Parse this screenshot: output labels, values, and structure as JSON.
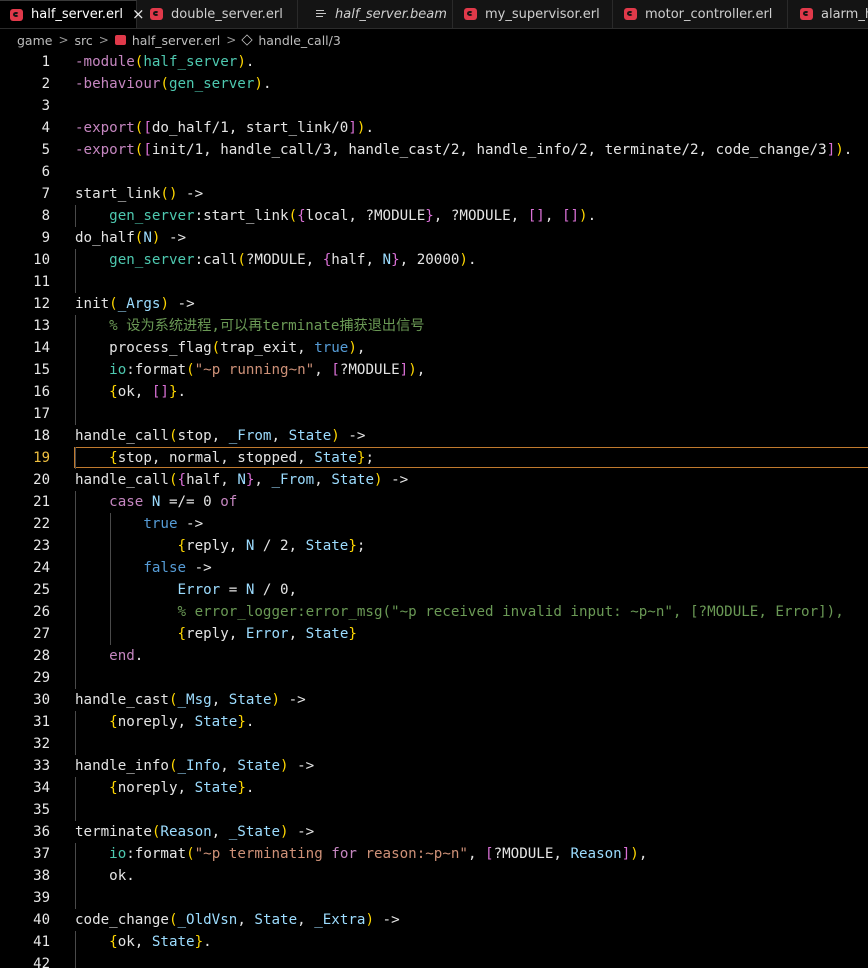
{
  "tabs": [
    {
      "label": "half_server.erl",
      "active": true,
      "icon": "erlang-file-icon",
      "close": "×"
    },
    {
      "label": "double_server.erl",
      "active": false,
      "icon": "erlang-file-icon"
    },
    {
      "label": "half_server.beam",
      "active": false,
      "icon": "beam-file-icon"
    },
    {
      "label": "my_supervisor.erl",
      "active": false,
      "icon": "erlang-file-icon"
    },
    {
      "label": "motor_controller.erl",
      "active": false,
      "icon": "erlang-file-icon"
    },
    {
      "label": "alarm_ha",
      "active": false,
      "icon": "erlang-file-icon"
    }
  ],
  "breadcrumb": {
    "parts": [
      "game",
      "src",
      "half_server.erl",
      "handle_call/3"
    ],
    "separator": ">"
  },
  "editor": {
    "current_line": 19,
    "lines": [
      {
        "n": "1",
        "t": [
          [
            "-module",
            "kw"
          ],
          [
            "(",
            "p1"
          ],
          [
            "half_server",
            "mod"
          ],
          [
            ")",
            "p1"
          ],
          [
            ".",
            "plain"
          ]
        ]
      },
      {
        "n": "2",
        "t": [
          [
            "-behaviour",
            "kw"
          ],
          [
            "(",
            "p1"
          ],
          [
            "gen_server",
            "mod"
          ],
          [
            ")",
            "p1"
          ],
          [
            ".",
            "plain"
          ]
        ]
      },
      {
        "n": "3",
        "t": []
      },
      {
        "n": "4",
        "t": [
          [
            "-export",
            "kw"
          ],
          [
            "(",
            "p1"
          ],
          [
            "[",
            "p2"
          ],
          [
            "do_half/1, start_link/0",
            "plain"
          ],
          [
            "]",
            "p2"
          ],
          [
            ")",
            "p1"
          ],
          [
            ".",
            "plain"
          ]
        ]
      },
      {
        "n": "5",
        "t": [
          [
            "-export",
            "kw"
          ],
          [
            "(",
            "p1"
          ],
          [
            "[",
            "p2"
          ],
          [
            "init/1, handle_call/3, handle_cast/2, handle_info/2, terminate/2, code_change/3",
            "plain"
          ],
          [
            "]",
            "p2"
          ],
          [
            ")",
            "p1"
          ],
          [
            ".",
            "plain"
          ]
        ]
      },
      {
        "n": "6",
        "t": []
      },
      {
        "n": "7",
        "t": [
          [
            "start_link",
            "fn"
          ],
          [
            "()",
            "p1"
          ],
          [
            " ->",
            "plain"
          ]
        ]
      },
      {
        "n": "8",
        "t": [
          [
            "    ",
            "plain"
          ],
          [
            "gen_server",
            "mod"
          ],
          [
            ":start_link",
            "plain"
          ],
          [
            "(",
            "p1"
          ],
          [
            "{",
            "p2"
          ],
          [
            "local, ?MODULE",
            "plain"
          ],
          [
            "}",
            "p2"
          ],
          [
            ", ?MODULE, ",
            "plain"
          ],
          [
            "[]",
            "p2"
          ],
          [
            ", ",
            "plain"
          ],
          [
            "[]",
            "p2"
          ],
          [
            ")",
            "p1"
          ],
          [
            ".",
            "plain"
          ]
        ]
      },
      {
        "n": "9",
        "t": [
          [
            "do_half",
            "fn"
          ],
          [
            "(",
            "p1"
          ],
          [
            "N",
            "var"
          ],
          [
            ")",
            "p1"
          ],
          [
            " ->",
            "plain"
          ]
        ]
      },
      {
        "n": "10",
        "t": [
          [
            "    ",
            "plain"
          ],
          [
            "gen_server",
            "mod"
          ],
          [
            ":call",
            "plain"
          ],
          [
            "(",
            "p1"
          ],
          [
            "?MODULE, ",
            "plain"
          ],
          [
            "{",
            "p2"
          ],
          [
            "half, ",
            "plain"
          ],
          [
            "N",
            "var"
          ],
          [
            "}",
            "p2"
          ],
          [
            ", 20000",
            "plain"
          ],
          [
            ")",
            "p1"
          ],
          [
            ".",
            "plain"
          ]
        ]
      },
      {
        "n": "11",
        "t": []
      },
      {
        "n": "12",
        "t": [
          [
            "init",
            "fn"
          ],
          [
            "(",
            "p1"
          ],
          [
            "_Args",
            "var"
          ],
          [
            ")",
            "p1"
          ],
          [
            " ->",
            "plain"
          ]
        ]
      },
      {
        "n": "13",
        "t": [
          [
            "    ",
            "plain"
          ],
          [
            "% 设为系统进程,可以再terminate捕获退出信号",
            "com"
          ]
        ]
      },
      {
        "n": "14",
        "t": [
          [
            "    process_flag",
            "plain"
          ],
          [
            "(",
            "p1"
          ],
          [
            "trap_exit, ",
            "plain"
          ],
          [
            "true",
            "bool"
          ],
          [
            ")",
            "p1"
          ],
          [
            ",",
            "plain"
          ]
        ]
      },
      {
        "n": "15",
        "t": [
          [
            "    ",
            "plain"
          ],
          [
            "io",
            "mod"
          ],
          [
            ":format",
            "plain"
          ],
          [
            "(",
            "p1"
          ],
          [
            "\"~p running~n\"",
            "str"
          ],
          [
            ", ",
            "plain"
          ],
          [
            "[",
            "p2"
          ],
          [
            "?MODULE",
            "plain"
          ],
          [
            "]",
            "p2"
          ],
          [
            ")",
            "p1"
          ],
          [
            ",",
            "plain"
          ]
        ]
      },
      {
        "n": "16",
        "t": [
          [
            "    ",
            "plain"
          ],
          [
            "{",
            "p1"
          ],
          [
            "ok, ",
            "plain"
          ],
          [
            "[]",
            "p2"
          ],
          [
            "}",
            "p1"
          ],
          [
            ".",
            "plain"
          ]
        ]
      },
      {
        "n": "17",
        "t": []
      },
      {
        "n": "18",
        "t": [
          [
            "handle_call",
            "fn"
          ],
          [
            "(",
            "p1"
          ],
          [
            "stop, ",
            "plain"
          ],
          [
            "_From",
            "var"
          ],
          [
            ", ",
            "plain"
          ],
          [
            "State",
            "var"
          ],
          [
            ")",
            "p1"
          ],
          [
            " ->",
            "plain"
          ]
        ]
      },
      {
        "n": "19",
        "t": [
          [
            "    ",
            "plain"
          ],
          [
            "{",
            "p1"
          ],
          [
            "stop, normal, stopped, ",
            "plain"
          ],
          [
            "State",
            "var"
          ],
          [
            "}",
            "p1"
          ],
          [
            ";",
            "plain"
          ]
        ]
      },
      {
        "n": "20",
        "t": [
          [
            "handle_call",
            "fn"
          ],
          [
            "(",
            "p1"
          ],
          [
            "{",
            "p2"
          ],
          [
            "half, ",
            "plain"
          ],
          [
            "N",
            "var"
          ],
          [
            "}",
            "p2"
          ],
          [
            ", ",
            "plain"
          ],
          [
            "_From",
            "var"
          ],
          [
            ", ",
            "plain"
          ],
          [
            "State",
            "var"
          ],
          [
            ")",
            "p1"
          ],
          [
            " ->",
            "plain"
          ]
        ]
      },
      {
        "n": "21",
        "t": [
          [
            "    ",
            "plain"
          ],
          [
            "case",
            "ctl"
          ],
          [
            " ",
            "plain"
          ],
          [
            "N",
            "var"
          ],
          [
            " =/= 0 ",
            "plain"
          ],
          [
            "of",
            "ctl"
          ]
        ]
      },
      {
        "n": "22",
        "t": [
          [
            "        ",
            "plain"
          ],
          [
            "true",
            "bool"
          ],
          [
            " ->",
            "plain"
          ]
        ]
      },
      {
        "n": "23",
        "t": [
          [
            "            ",
            "plain"
          ],
          [
            "{",
            "p1"
          ],
          [
            "reply, ",
            "plain"
          ],
          [
            "N",
            "var"
          ],
          [
            " / 2, ",
            "plain"
          ],
          [
            "State",
            "var"
          ],
          [
            "}",
            "p1"
          ],
          [
            ";",
            "plain"
          ]
        ]
      },
      {
        "n": "24",
        "t": [
          [
            "        ",
            "plain"
          ],
          [
            "false",
            "bool"
          ],
          [
            " ->",
            "plain"
          ]
        ]
      },
      {
        "n": "25",
        "t": [
          [
            "            ",
            "plain"
          ],
          [
            "Error",
            "var"
          ],
          [
            " = ",
            "plain"
          ],
          [
            "N",
            "var"
          ],
          [
            " / 0,",
            "plain"
          ]
        ]
      },
      {
        "n": "26",
        "t": [
          [
            "            ",
            "plain"
          ],
          [
            "% error_logger:error_msg(\"~p received invalid input: ~p~n\", [?MODULE, Error]),",
            "com"
          ]
        ]
      },
      {
        "n": "27",
        "t": [
          [
            "            ",
            "plain"
          ],
          [
            "{",
            "p1"
          ],
          [
            "reply, ",
            "plain"
          ],
          [
            "Error",
            "var"
          ],
          [
            ", ",
            "plain"
          ],
          [
            "State",
            "var"
          ],
          [
            "}",
            "p1"
          ]
        ]
      },
      {
        "n": "28",
        "t": [
          [
            "    ",
            "plain"
          ],
          [
            "end",
            "ctl"
          ],
          [
            ".",
            "plain"
          ]
        ]
      },
      {
        "n": "29",
        "t": []
      },
      {
        "n": "30",
        "t": [
          [
            "handle_cast",
            "fn"
          ],
          [
            "(",
            "p1"
          ],
          [
            "_Msg",
            "var"
          ],
          [
            ", ",
            "plain"
          ],
          [
            "State",
            "var"
          ],
          [
            ")",
            "p1"
          ],
          [
            " ->",
            "plain"
          ]
        ]
      },
      {
        "n": "31",
        "t": [
          [
            "    ",
            "plain"
          ],
          [
            "{",
            "p1"
          ],
          [
            "noreply, ",
            "plain"
          ],
          [
            "State",
            "var"
          ],
          [
            "}",
            "p1"
          ],
          [
            ".",
            "plain"
          ]
        ]
      },
      {
        "n": "32",
        "t": []
      },
      {
        "n": "33",
        "t": [
          [
            "handle_info",
            "fn"
          ],
          [
            "(",
            "p1"
          ],
          [
            "_Info",
            "var"
          ],
          [
            ", ",
            "plain"
          ],
          [
            "State",
            "var"
          ],
          [
            ")",
            "p1"
          ],
          [
            " ->",
            "plain"
          ]
        ]
      },
      {
        "n": "34",
        "t": [
          [
            "    ",
            "plain"
          ],
          [
            "{",
            "p1"
          ],
          [
            "noreply, ",
            "plain"
          ],
          [
            "State",
            "var"
          ],
          [
            "}",
            "p1"
          ],
          [
            ".",
            "plain"
          ]
        ]
      },
      {
        "n": "35",
        "t": []
      },
      {
        "n": "36",
        "t": [
          [
            "terminate",
            "fn"
          ],
          [
            "(",
            "p1"
          ],
          [
            "Reason",
            "var"
          ],
          [
            ", ",
            "plain"
          ],
          [
            "_State",
            "var"
          ],
          [
            ")",
            "p1"
          ],
          [
            " ->",
            "plain"
          ]
        ]
      },
      {
        "n": "37",
        "t": [
          [
            "    ",
            "plain"
          ],
          [
            "io",
            "mod"
          ],
          [
            ":format",
            "plain"
          ],
          [
            "(",
            "p1"
          ],
          [
            "\"~p terminating ",
            "str"
          ],
          [
            "for",
            "ctl"
          ],
          [
            " reason:~p~n\"",
            "str"
          ],
          [
            ", ",
            "plain"
          ],
          [
            "[",
            "p2"
          ],
          [
            "?MODULE, ",
            "plain"
          ],
          [
            "Reason",
            "var"
          ],
          [
            "]",
            "p2"
          ],
          [
            ")",
            "p1"
          ],
          [
            ",",
            "plain"
          ]
        ]
      },
      {
        "n": "38",
        "t": [
          [
            "    ok.",
            "plain"
          ]
        ]
      },
      {
        "n": "39",
        "t": []
      },
      {
        "n": "40",
        "t": [
          [
            "code_change",
            "fn"
          ],
          [
            "(",
            "p1"
          ],
          [
            "_OldVsn",
            "var"
          ],
          [
            ", ",
            "plain"
          ],
          [
            "State",
            "var"
          ],
          [
            ", ",
            "plain"
          ],
          [
            "_Extra",
            "var"
          ],
          [
            ")",
            "p1"
          ],
          [
            " ->",
            "plain"
          ]
        ]
      },
      {
        "n": "41",
        "t": [
          [
            "    ",
            "plain"
          ],
          [
            "{",
            "p1"
          ],
          [
            "ok, ",
            "plain"
          ],
          [
            "State",
            "var"
          ],
          [
            "}",
            "p1"
          ],
          [
            ".",
            "plain"
          ]
        ]
      },
      {
        "n": "42",
        "t": []
      }
    ]
  }
}
